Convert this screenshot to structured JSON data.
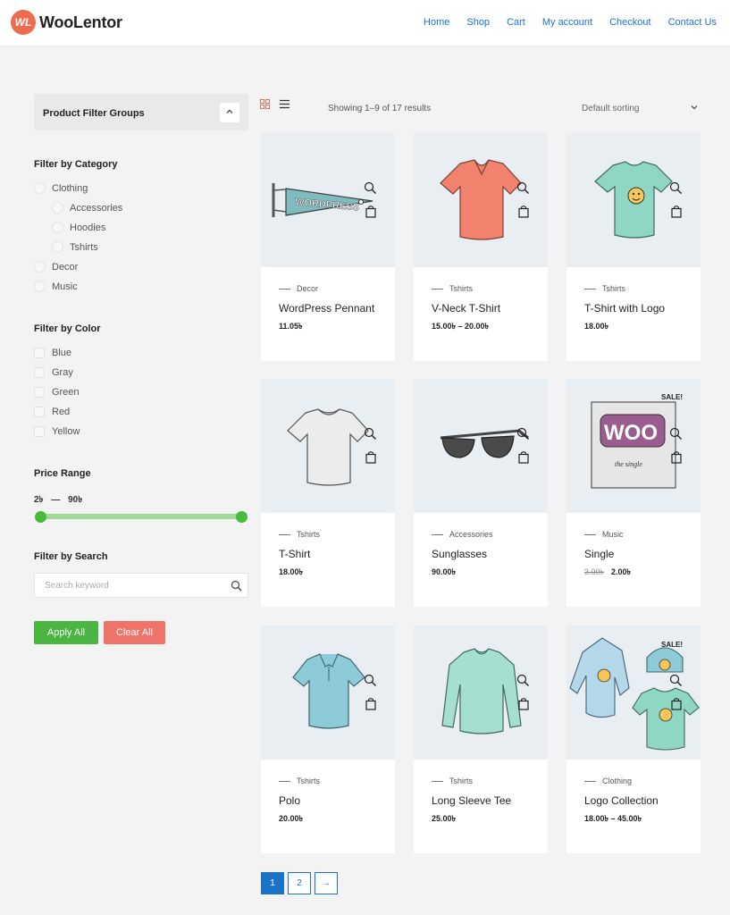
{
  "brand": {
    "logo_mark": "WL",
    "name": "WooLentor",
    "accent": "#ef6b4f"
  },
  "nav": [
    "Home",
    "Shop",
    "Cart",
    "My account",
    "Checkout",
    "Contact Us"
  ],
  "sidebar": {
    "groups_title": "Product Filter Groups",
    "category": {
      "title": "Filter by Category",
      "items": [
        "Clothing",
        "Accessories",
        "Hoodies",
        "Tshirts",
        "Decor",
        "Music"
      ]
    },
    "color": {
      "title": "Filter by Color",
      "items": [
        "Blue",
        "Gray",
        "Green",
        "Red",
        "Yellow"
      ]
    },
    "price": {
      "title": "Price Range",
      "min": "2৳",
      "sep": "—",
      "max": "90৳"
    },
    "search": {
      "title": "Filter by Search",
      "placeholder": "Search keyword",
      "value": ""
    },
    "apply_label": "Apply All",
    "clear_label": "Clear All"
  },
  "toolbar": {
    "result_count": "Showing 1–9 of 17 results",
    "sorting": "Default sorting"
  },
  "products": [
    {
      "category": "Decor",
      "name": "WordPress Pennant",
      "price": "11.05৳",
      "old_price": ""
    },
    {
      "category": "Tshirts",
      "name": "V-Neck T-Shirt",
      "price": "15.00৳  – 20.00৳",
      "old_price": ""
    },
    {
      "category": "Tshirts",
      "name": "T-Shirt with Logo",
      "price": "18.00৳",
      "old_price": ""
    },
    {
      "category": "Tshirts",
      "name": "T-Shirt",
      "price": "18.00৳",
      "old_price": ""
    },
    {
      "category": "Accessories",
      "name": "Sunglasses",
      "price": "90.00৳",
      "old_price": ""
    },
    {
      "category": "Music",
      "name": "Single",
      "price": "2.00৳",
      "old_price": "3.00৳"
    },
    {
      "category": "Tshirts",
      "name": "Polo",
      "price": "20.00৳",
      "old_price": ""
    },
    {
      "category": "Tshirts",
      "name": "Long Sleeve Tee",
      "price": "25.00৳",
      "old_price": ""
    },
    {
      "category": "Clothing",
      "name": "Logo Collection",
      "price": "18.00৳  – 45.00৳",
      "old_price": ""
    }
  ],
  "art": {
    "pennant_text": "WORDPRESS",
    "sale_badge": "SALE!",
    "album_text": "WOO",
    "album_sub": "the single"
  },
  "pagination": {
    "pages": [
      "1",
      "2"
    ],
    "next": "→",
    "current": "1"
  }
}
